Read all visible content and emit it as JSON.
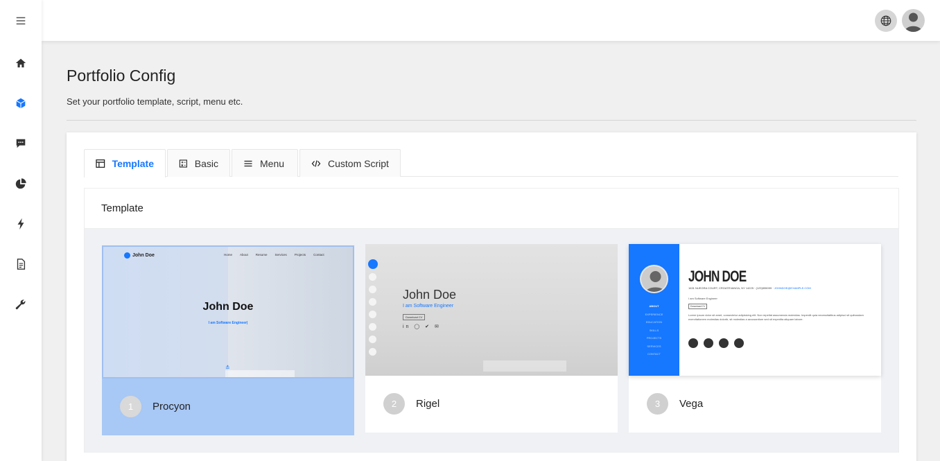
{
  "sidebar": {
    "items": [
      {
        "icon": "menu-icon"
      },
      {
        "icon": "home-icon"
      },
      {
        "icon": "cube-icon",
        "active": true
      },
      {
        "icon": "message-icon"
      },
      {
        "icon": "pie-chart-icon"
      },
      {
        "icon": "lightning-icon"
      },
      {
        "icon": "document-icon"
      },
      {
        "icon": "wrench-icon"
      }
    ],
    "active_color": "#1677ff"
  },
  "topbar": {
    "language_icon": "globe-icon",
    "avatar_icon": "user-avatar-icon"
  },
  "page": {
    "title": "Portfolio Config",
    "subtitle": "Set your portfolio template, script, menu etc."
  },
  "tabs": [
    {
      "label": "Template",
      "icon": "layout-icon",
      "active": true
    },
    {
      "label": "Basic",
      "icon": "calculator-icon"
    },
    {
      "label": "Menu",
      "icon": "list-icon"
    },
    {
      "label": "Custom Script",
      "icon": "code-icon"
    }
  ],
  "template_section": {
    "heading": "Template",
    "templates": [
      {
        "number": "1",
        "name": "Procyon",
        "selected": true,
        "preview": {
          "logo": "John Doe",
          "nav": [
            "Home",
            "About",
            "Resume",
            "Services",
            "Projects",
            "Contact"
          ],
          "name": "John Doe",
          "tagline": "I am Software Engineer|"
        }
      },
      {
        "number": "2",
        "name": "Rigel",
        "preview": {
          "name": "John Doe",
          "tagline": "I am Software Engineer",
          "button": "Download CV"
        }
      },
      {
        "number": "3",
        "name": "Vega",
        "preview": {
          "name": "JOHN DOE",
          "address": "1631 NUEGRA COURT, CROATEVANGA, NY 14225 · (123)555099 ·",
          "email": "JOHNDOE@EXAMPLE.COM",
          "role": "I am Software Engineer",
          "button": "Download CV",
          "bio": "Lorem ipsum dolor sit amet, consectetur adipisicing elit. Non repellat assumenda molestias. Imperdit quia necessitatibus adipisci sit quibusdam exercitationem molestias dolorib, sit molestias a accusantium sed sit expedita aliquam labore.",
          "menu": [
            "ABOUT",
            "EXPERIENCE",
            "EDUCATION",
            "SKILLS",
            "PROJECTS",
            "SERVICES",
            "CONTACT"
          ]
        }
      }
    ]
  }
}
